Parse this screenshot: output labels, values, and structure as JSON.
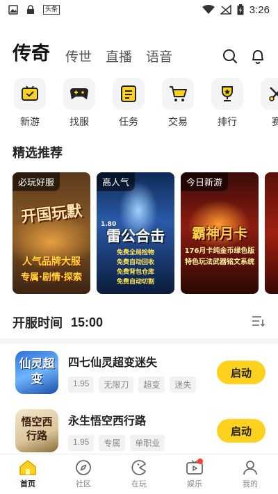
{
  "status_bar": {
    "time": "3:26",
    "toutiao_label": "头条"
  },
  "top_nav": {
    "tabs": [
      "传奇",
      "传世",
      "直播",
      "语音"
    ]
  },
  "quick_menu": [
    {
      "label": "新游",
      "icon": "new-game-icon"
    },
    {
      "label": "找服",
      "icon": "gamepad-icon"
    },
    {
      "label": "任务",
      "icon": "task-icon"
    },
    {
      "label": "交易",
      "icon": "cart-icon"
    },
    {
      "label": "排行",
      "icon": "trophy-icon"
    },
    {
      "label": "赛",
      "icon": "sword-icon"
    }
  ],
  "featured": {
    "title": "精选推荐",
    "cards": [
      {
        "tag": "必玩好服",
        "art_title": "开国玩默",
        "art_sub": "人气品牌大服",
        "art_sub2": "专属·剧情·探索"
      },
      {
        "tag": "高人气",
        "art_title": "雷公合击",
        "art_version": "1.80",
        "art_lines": [
          "免费全局捡物",
          "免费自动回收",
          "免费背包仓库",
          "免费自动切割"
        ]
      },
      {
        "tag": "今日新游",
        "art_title": "霸神月卡",
        "art_sub": "176月卡纯金币绿色版",
        "art_sub2": "特色玩法武器铭文系统"
      }
    ]
  },
  "server_time": {
    "title": "开服时间",
    "time": "15:00"
  },
  "games": [
    {
      "name": "四七仙灵超变迷失",
      "tags": [
        "1.95",
        "无限刀",
        "超变",
        "迷失"
      ],
      "icon_text": "仙灵超变",
      "button": "启动"
    },
    {
      "name": "永生悟空西行路",
      "tags": [
        "1.95",
        "专属",
        "单职业"
      ],
      "icon_text": "悟空西行路",
      "button": "启动"
    }
  ],
  "bottom_nav": [
    {
      "label": "首页",
      "icon": "home-icon"
    },
    {
      "label": "社区",
      "icon": "compass-icon"
    },
    {
      "label": "在玩",
      "icon": "pacman-icon"
    },
    {
      "label": "娱乐",
      "icon": "tv-icon"
    },
    {
      "label": "我的",
      "icon": "user-icon"
    }
  ],
  "colors": {
    "accent": "#ffd21f",
    "badge": "#ff3b30"
  }
}
